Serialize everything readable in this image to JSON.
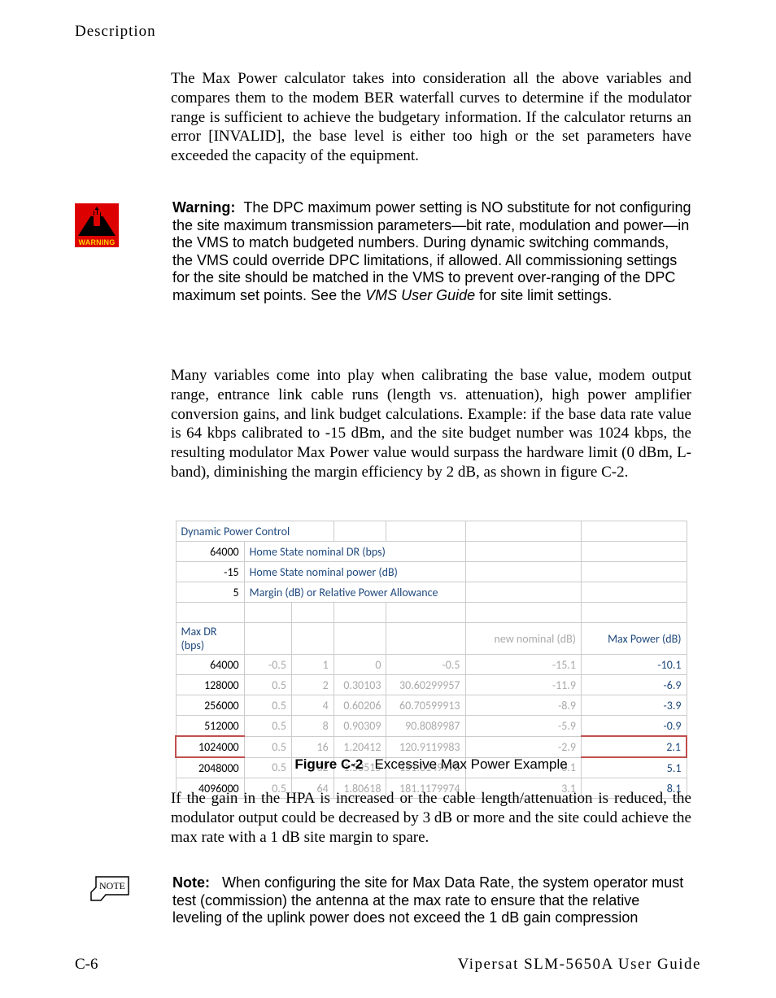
{
  "header": {
    "section": "Description"
  },
  "paragraphs": {
    "p1": "The Max Power calculator takes into consideration all the above variables and compares them to the modem BER waterfall curves to determine if the modulator range is sufficient to achieve the budgetary information. If the calculator returns an error [INVALID], the base level is either too high or the set parameters have exceeded the capacity of the equipment.",
    "p2": "Many variables come into play when calibrating the base value, modem output range, entrance link cable runs (length vs. attenuation), high power amplifier conversion gains, and link budget calculations. Example: if the base data rate value is 64 kbps calibrated to -15 dBm, and the site budget number was 1024 kbps, the resulting modulator Max Power value would surpass the hardware limit (0 dBm, L-band), diminishing the margin efficiency by 2 dB, as shown in figure C-2.",
    "p3": "If the gain in the HPA is increased or the cable length/attenuation is reduced, the modulator output could be decreased by 3 dB or more and the site could achieve the max rate with a 1 dB site margin to spare."
  },
  "warning": {
    "label": "Warning:",
    "icon_caption": "WARNING",
    "text_before_italic": "The DPC maximum power setting is NO substitute for not configuring the site maximum transmission parameters—bit rate, modulation and power—in the VMS to match budgeted numbers. During dynamic switching commands, the VMS could override DPC limitations, if allowed. All commissioning settings for the site should be matched in the VMS to prevent over-ranging of the DPC maximum set points. See the ",
    "italic": "VMS User Guide",
    "text_after_italic": " for site limit settings."
  },
  "note": {
    "label": "Note:",
    "text": "When configuring the site for Max Data Rate, the system operator must test (commission) the antenna at the max rate to ensure that the relative leveling of the uplink power does not exceed the 1 dB gain compression"
  },
  "figure": {
    "label": "Figure C-2",
    "caption": "Excessive Max Power Example"
  },
  "table": {
    "title": "Dynamic Power Control",
    "inputs": [
      {
        "value": "64000",
        "label": "Home State nominal DR (bps)"
      },
      {
        "value": "-15",
        "label": "Home State nominal power (dB)"
      },
      {
        "value": "5",
        "label": "Margin (dB) or Relative Power Allowance"
      }
    ],
    "headers": {
      "col0": "Max DR (bps)",
      "col5": "new nominal (dB)",
      "col6": "Max Power (dB)"
    },
    "rows": [
      {
        "dr": "64000",
        "a": "-0.5",
        "b": "1",
        "c": "0",
        "d": "-0.5",
        "nom": "-15.1",
        "max": "-10.1",
        "hl": false
      },
      {
        "dr": "128000",
        "a": "0.5",
        "b": "2",
        "c": "0.30103",
        "d": "30.60299957",
        "nom": "-11.9",
        "max": "-6.9",
        "hl": false
      },
      {
        "dr": "256000",
        "a": "0.5",
        "b": "4",
        "c": "0.60206",
        "d": "60.70599913",
        "nom": "-8.9",
        "max": "-3.9",
        "hl": false
      },
      {
        "dr": "512000",
        "a": "0.5",
        "b": "8",
        "c": "0.90309",
        "d": "90.8089987",
        "nom": "-5.9",
        "max": "-0.9",
        "hl": false
      },
      {
        "dr": "1024000",
        "a": "0.5",
        "b": "16",
        "c": "1.20412",
        "d": "120.9119983",
        "nom": "-2.9",
        "max": "2.1",
        "hl": true
      },
      {
        "dr": "2048000",
        "a": "0.5",
        "b": "32",
        "c": "1.50515",
        "d": "151.0149978",
        "nom": "0.1",
        "max": "5.1",
        "hl": false
      },
      {
        "dr": "4096000",
        "a": "0.5",
        "b": "64",
        "c": "1.80618",
        "d": "181.1179974",
        "nom": "3.1",
        "max": "8.1",
        "hl": false
      }
    ]
  },
  "footer": {
    "left": "C-6",
    "right": "Vipersat SLM-5650A User Guide"
  }
}
